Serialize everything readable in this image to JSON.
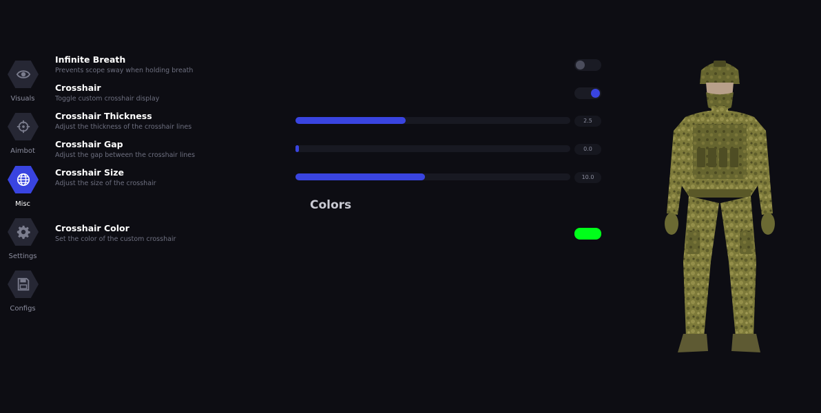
{
  "sidebar": {
    "items": [
      {
        "label": "Visuals",
        "icon": "eye-icon",
        "active": false
      },
      {
        "label": "Aimbot",
        "icon": "crosshair-icon",
        "active": false
      },
      {
        "label": "Misc",
        "icon": "globe-icon",
        "active": true
      },
      {
        "label": "Settings",
        "icon": "gear-icon",
        "active": false
      },
      {
        "label": "Configs",
        "icon": "save-icon",
        "active": false
      }
    ]
  },
  "settings": {
    "infinite_breath": {
      "title": "Infinite Breath",
      "description": "Prevents scope sway when holding breath",
      "enabled": false
    },
    "crosshair": {
      "title": "Crosshair",
      "description": "Toggle custom crosshair display",
      "enabled": true
    },
    "crosshair_thickness": {
      "title": "Crosshair Thickness",
      "description": "Adjust the thickness of the crosshair lines",
      "value": "2.5",
      "fill_fraction": 0.4
    },
    "crosshair_gap": {
      "title": "Crosshair Gap",
      "description": "Adjust the gap between the crosshair lines",
      "value": "0.0",
      "fill_fraction": 0.0
    },
    "crosshair_size": {
      "title": "Crosshair Size",
      "description": "Adjust the size of the crosshair",
      "value": "10.0",
      "fill_fraction": 0.47
    }
  },
  "colors_section": {
    "header": "Colors",
    "crosshair_color": {
      "title": "Crosshair Color",
      "description": "Set the color of the custom crosshair",
      "color": "#00ff1a"
    }
  },
  "theme": {
    "accent": "#3944e0",
    "background": "#0d0d13"
  }
}
